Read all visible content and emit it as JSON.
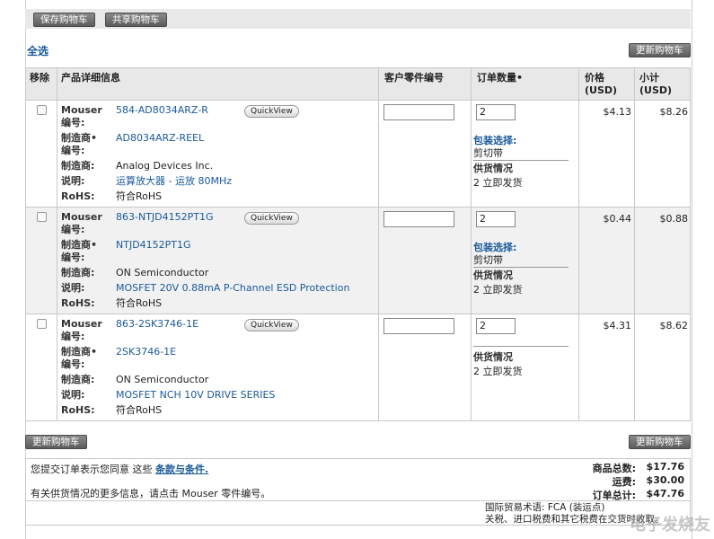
{
  "toolbar": {
    "save_cart": "保存购物车",
    "share_cart": "共享购物车"
  },
  "select_all": "全选",
  "update_cart": "更新购物车",
  "headers": {
    "remove": "移除",
    "product_details": "产品详细信息",
    "customer_part": "客户零件编号",
    "order_qty": "订单数量",
    "price": "价格",
    "price_unit": "(USD)",
    "subtotal": "小计",
    "subtotal_unit": "(USD)"
  },
  "labels": {
    "mouser_no": "Mouser",
    "no": "编号:",
    "mfr": "制造商",
    "desc": "说明:",
    "rohs": "RoHS:",
    "bullet": "•",
    "quickview": "QuickView",
    "pkg": "包装选择:",
    "avail": "供货情况"
  },
  "items": [
    {
      "mouser_part": "584-AD8034ARZ-R",
      "mfr_part": "AD8034ARZ-REEL",
      "manufacturer": "Analog Devices Inc.",
      "description": "运算放大器 - 运放 80MHz",
      "rohs": "符合RoHS",
      "qty": "2",
      "packaging": "剪切带",
      "availability": "2 立即发货",
      "price": "$4.13",
      "subtotal": "$8.26"
    },
    {
      "mouser_part": "863-NTJD4152PT1G",
      "mfr_part": "NTJD4152PT1G",
      "manufacturer": "ON Semiconductor",
      "description": "MOSFET 20V 0.88mA P-Channel ESD Protection",
      "rohs": "符合RoHS",
      "qty": "2",
      "packaging": "剪切带",
      "availability": "2 立即发货",
      "price": "$0.44",
      "subtotal": "$0.88"
    },
    {
      "mouser_part": "863-2SK3746-1E",
      "mfr_part": "2SK3746-1E",
      "manufacturer": "ON Semiconductor",
      "description": "MOSFET NCH 10V DRIVE SERIES",
      "rohs": "符合RoHS",
      "qty": "2",
      "availability": "2 立即发货",
      "price": "$4.31",
      "subtotal": "$8.62"
    }
  ],
  "footer": {
    "terms_prefix": "您提交订单表示您同意 这些",
    "terms_link": "条款与条件.",
    "info": "有关供货情况的更多信息，请点击 Mouser 零件编号。",
    "goods_total_label": "商品总数:",
    "goods_total": "$17.76",
    "shipping_label": "运费:",
    "shipping": "$30.00",
    "order_total_label": "订单总计:",
    "order_total": "$47.76",
    "incoterm": "国际贸易术语: FCA (装运点)",
    "duties": "关税、进口税费和其它税费在交货时收取。"
  },
  "watermark": "电子发烧友"
}
